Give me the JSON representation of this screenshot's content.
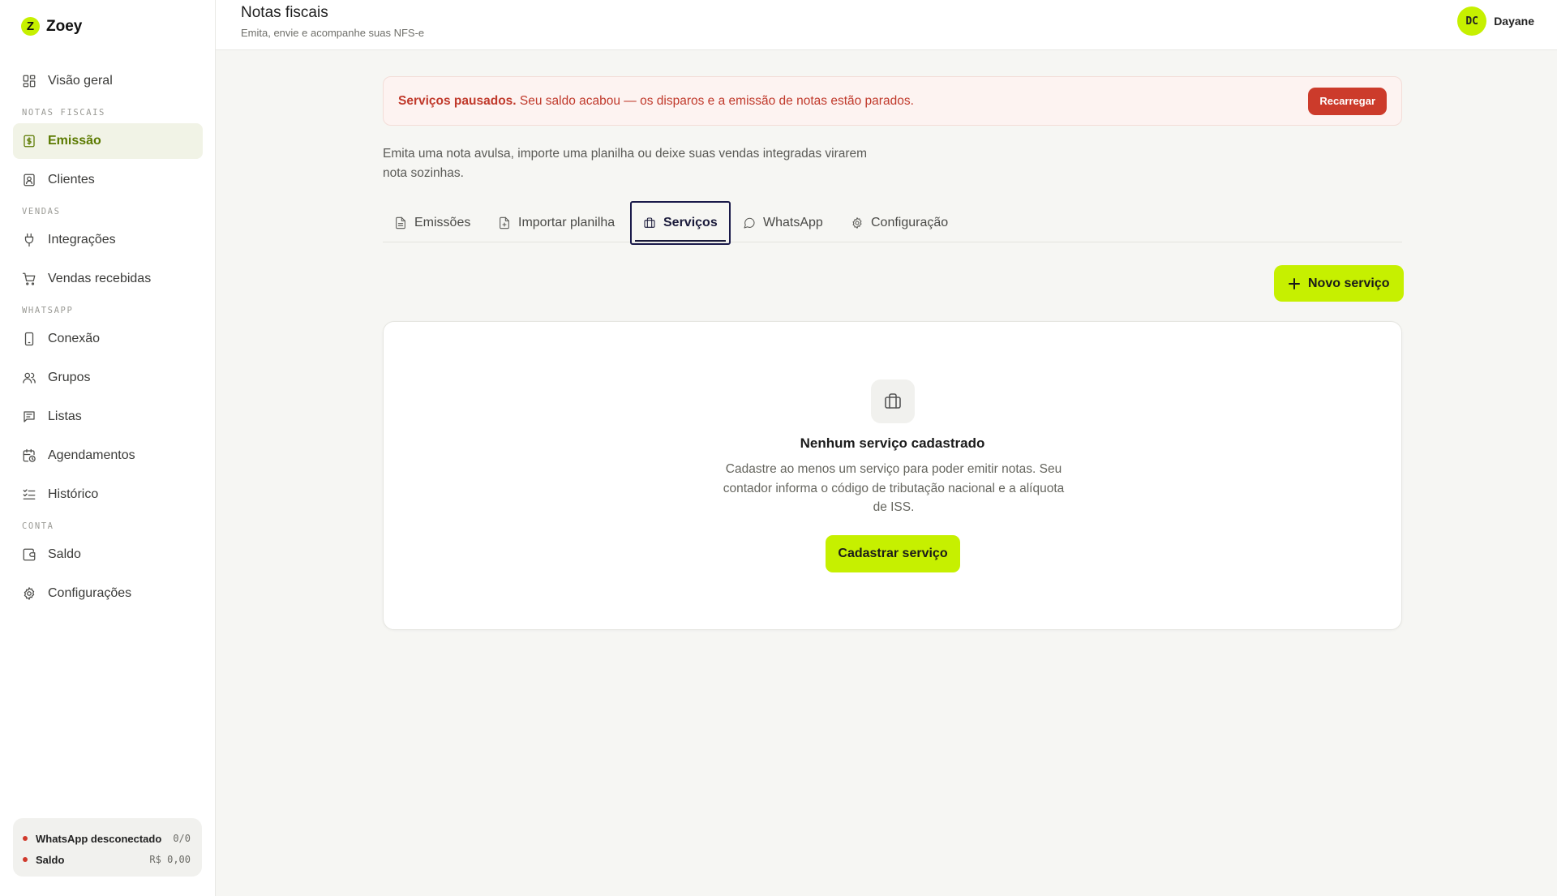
{
  "brand": {
    "name": "Zoey",
    "logo_letter": "Z",
    "accent_color": "#c6f000"
  },
  "sidebar": {
    "items": [
      {
        "type": "item",
        "label": "Visão geral",
        "icon": "grid-icon"
      },
      {
        "type": "section",
        "label": "NOTAS FISCAIS"
      },
      {
        "type": "item",
        "label": "Emissão",
        "icon": "receipt-icon",
        "active": true
      },
      {
        "type": "item",
        "label": "Clientes",
        "icon": "contact-icon"
      },
      {
        "type": "section",
        "label": "VENDAS"
      },
      {
        "type": "item",
        "label": "Integrações",
        "icon": "plug-icon"
      },
      {
        "type": "item",
        "label": "Vendas recebidas",
        "icon": "cart-icon"
      },
      {
        "type": "section",
        "label": "WHATSAPP"
      },
      {
        "type": "item",
        "label": "Conexão",
        "icon": "phone-icon"
      },
      {
        "type": "item",
        "label": "Grupos",
        "icon": "users-icon"
      },
      {
        "type": "item",
        "label": "Listas",
        "icon": "list-icon"
      },
      {
        "type": "item",
        "label": "Agendamentos",
        "icon": "calendar-clock-icon"
      },
      {
        "type": "item",
        "label": "Histórico",
        "icon": "checklist-icon"
      },
      {
        "type": "section",
        "label": "CONTA"
      },
      {
        "type": "item",
        "label": "Saldo",
        "icon": "wallet-icon"
      },
      {
        "type": "item",
        "label": "Configurações",
        "icon": "gear-icon"
      }
    ],
    "status": {
      "whatsapp_label": "WhatsApp desconectado",
      "whatsapp_value": "0/0",
      "balance_label": "Saldo",
      "balance_value": "R$ 0,00"
    }
  },
  "header": {
    "title": "Notas fiscais",
    "subtitle": "Emita, envie e acompanhe suas NFS-e",
    "user_initials": "DC",
    "user_name": "Dayane"
  },
  "alert": {
    "strong": "Serviços pausados.",
    "message": " Seu saldo acabou — os disparos e a emissão de notas estão parados.",
    "button": "Recarregar",
    "color": "#cc3b2b"
  },
  "intro": "Emita uma nota avulsa, importe uma planilha ou deixe suas vendas integradas virarem nota sozinhas.",
  "tabs": [
    {
      "label": "Emissões",
      "icon": "file-icon"
    },
    {
      "label": "Importar planilha",
      "icon": "file-plus-icon"
    },
    {
      "label": "Serviços",
      "icon": "briefcase-icon",
      "active": true
    },
    {
      "label": "WhatsApp",
      "icon": "chat-icon"
    },
    {
      "label": "Configuração",
      "icon": "gear-icon"
    }
  ],
  "new_service_button": "Novo serviço",
  "empty": {
    "icon": "briefcase-icon",
    "title": "Nenhum serviço cadastrado",
    "description": "Cadastre ao menos um serviço para poder emitir notas. Seu contador informa o código de tributação nacional e a alíquota de ISS.",
    "button": "Cadastrar serviço"
  }
}
